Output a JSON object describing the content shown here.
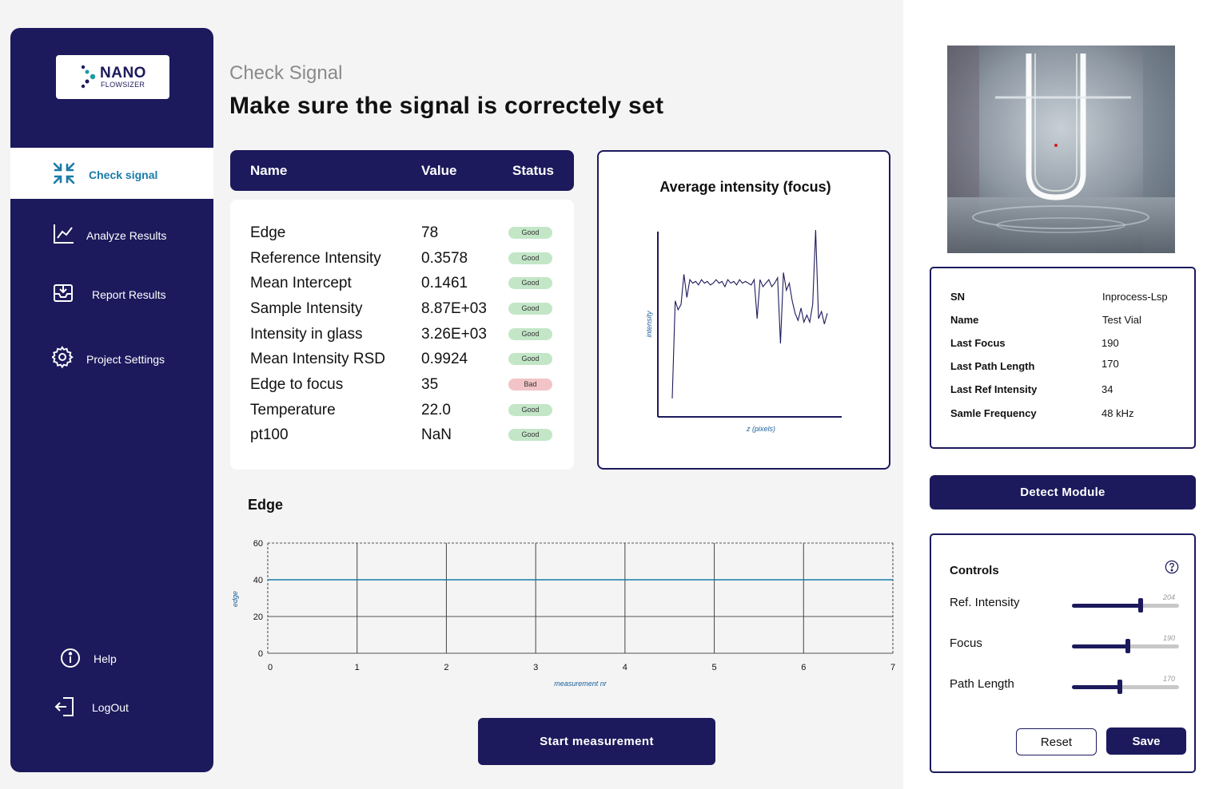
{
  "logo": {
    "brand": "NANO",
    "sub": "FLOWSIZER"
  },
  "nav": {
    "items": [
      {
        "label": "Check signal",
        "icon": "compress-arrows-icon",
        "active": true
      },
      {
        "label": "Analyze Results",
        "icon": "line-chart-icon"
      },
      {
        "label": "Report Results",
        "icon": "download-tray-icon"
      },
      {
        "label": "Project Settings",
        "icon": "gear-icon"
      }
    ],
    "help": "Help",
    "logout": "LogOut"
  },
  "header": {
    "subtitle": "Check Signal",
    "title": "Make sure the signal is correctely set"
  },
  "params": {
    "headers": [
      "Name",
      "Value",
      "Status"
    ],
    "rows": [
      {
        "name": "Edge",
        "value": "78",
        "status": "Good"
      },
      {
        "name": "Reference Intensity",
        "value": "0.3578",
        "status": "Good"
      },
      {
        "name": "Mean Intercept",
        "value": "0.1461",
        "status": "Good"
      },
      {
        "name": "Sample Intensity",
        "value": "8.87E+03",
        "status": "Good"
      },
      {
        "name": "Intensity in glass",
        "value": "3.26E+03",
        "status": "Good"
      },
      {
        "name": "Mean Intensity RSD",
        "value": "0.9924",
        "status": "Good"
      },
      {
        "name": "Edge to focus",
        "value": "35",
        "status": "Bad"
      },
      {
        "name": "Temperature",
        "value": "22.0",
        "status": "Good"
      },
      {
        "name": "pt100",
        "value": "NaN",
        "status": "Good"
      }
    ]
  },
  "chart_data": [
    {
      "type": "line",
      "title": "Average intensity (focus)",
      "xlabel": "z (pixels)",
      "ylabel": "intensity",
      "series": [
        {
          "values": [
            0.05,
            0.6,
            0.55,
            0.58,
            0.75,
            0.62,
            0.72,
            0.7,
            0.71,
            0.69,
            0.72,
            0.7,
            0.71,
            0.69,
            0.7,
            0.72,
            0.7,
            0.71,
            0.68,
            0.72,
            0.7,
            0.71,
            0.69,
            0.72,
            0.7,
            0.71,
            0.7,
            0.69,
            0.72,
            0.5,
            0.72,
            0.68,
            0.7,
            0.72,
            0.68,
            0.7,
            0.73,
            0.36,
            0.76,
            0.66,
            0.7,
            0.6,
            0.53,
            0.49,
            0.56,
            0.48,
            0.52,
            0.48,
            0.58,
            1.0,
            0.5,
            0.54,
            0.47,
            0.53
          ]
        }
      ]
    },
    {
      "type": "line",
      "title": "Edge",
      "xlabel": "measurement nr",
      "ylabel": "edge",
      "x": [
        0,
        1,
        2,
        3,
        4,
        5,
        6,
        7
      ],
      "xlim": [
        0,
        7
      ],
      "ylim": [
        0,
        60
      ],
      "yticks": [
        0,
        20,
        40,
        60
      ],
      "series": [
        {
          "values": [
            40,
            40,
            40,
            40,
            40,
            40,
            40,
            40
          ]
        }
      ],
      "grid": true
    }
  ],
  "device": {
    "rows": [
      {
        "key": "SN",
        "value": "Inprocess-Lsp"
      },
      {
        "key": "Name",
        "value": "Test Vial"
      },
      {
        "key": "Last Focus",
        "value": "190"
      },
      {
        "key": "Last Path Length",
        "value": "170"
      },
      {
        "key": "Last Ref Intensity",
        "value": "34"
      },
      {
        "key": "Samle Frequency",
        "value": "48 kHz"
      }
    ]
  },
  "buttons": {
    "start": "Start measurement",
    "detect": "Detect Module",
    "reset": "Reset",
    "save": "Save"
  },
  "controls": {
    "title": "Controls",
    "sliders": [
      {
        "label": "Ref. Intensity",
        "value": "204",
        "fraction": 0.64
      },
      {
        "label": "Focus",
        "value": "190",
        "fraction": 0.52
      },
      {
        "label": "Path Length",
        "value": "170",
        "fraction": 0.45
      }
    ]
  },
  "colors": {
    "navy": "#1c1a5c",
    "accent": "#1a7ba8",
    "good": "#c3e6c7",
    "bad": "#f2c4c7"
  }
}
